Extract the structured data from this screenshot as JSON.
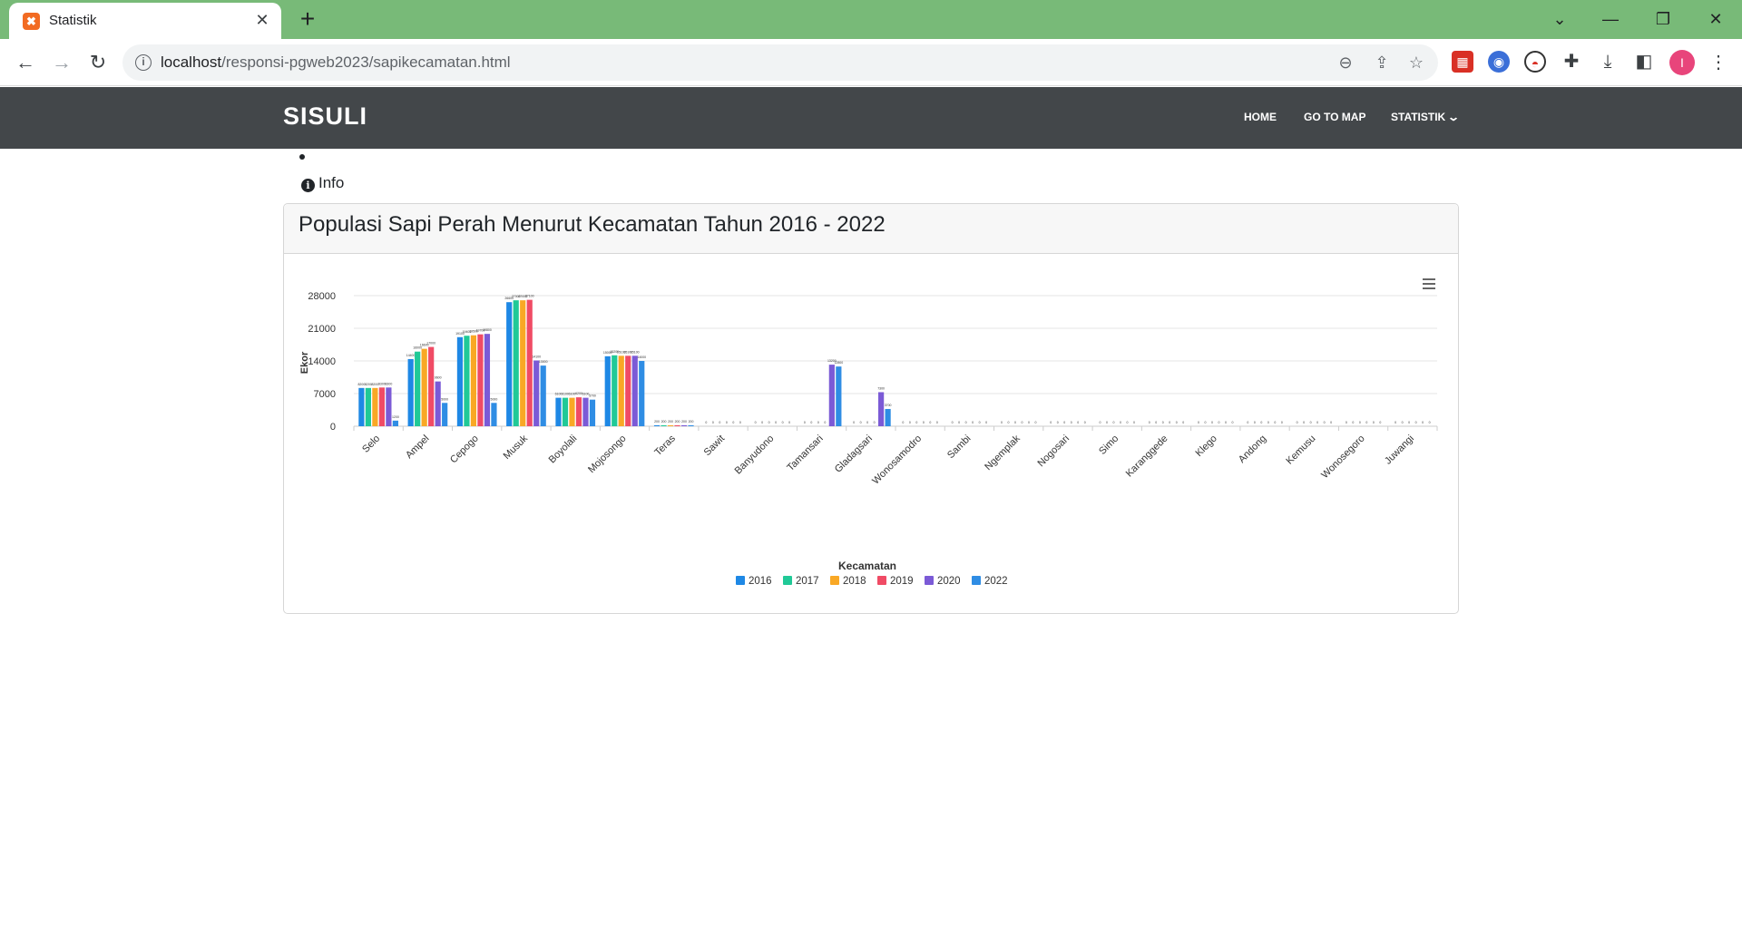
{
  "browser": {
    "tab_title": "Statistik",
    "tab_favicon": "xampp-icon",
    "url_host": "localhost",
    "url_path": "/responsi-pgweb2023/sapikecamatan.html",
    "profile_initial": "I"
  },
  "navbar": {
    "brand": "SISULI",
    "links": [
      "HOME",
      "GO TO MAP",
      "STATISTIK"
    ]
  },
  "info_label": "Info",
  "card_title": "Populasi Sapi Perah Menurut Kecamatan Tahun 2016 - 2022",
  "chart_data": {
    "type": "bar",
    "xlabel": "Kecamatan",
    "ylabel": "Ekor",
    "yticks": [
      "0",
      "7000",
      "14000",
      "21000",
      "28000"
    ],
    "ylim": [
      0,
      28000
    ],
    "grid": true,
    "legend_position": "bottom-center",
    "categories": [
      "Selo",
      "Ampel",
      "Cepogo",
      "Musuk",
      "Boyolali",
      "Mojosongo",
      "Teras",
      "Sawit",
      "Banyudono",
      "Tamansari",
      "Gladagsari",
      "Wonosamodro",
      "Sambi",
      "Ngemplak",
      "Nogosari",
      "Simo",
      "Karanggede",
      "Klego",
      "Andong",
      "Kemusu",
      "Wonosegoro",
      "Juwangi"
    ],
    "series": [
      {
        "name": "2016",
        "color": "#1e88e5",
        "values": [
          8200,
          14400,
          19100,
          26600,
          6100,
          15000,
          200,
          0,
          0,
          0,
          0,
          0,
          0,
          0,
          0,
          0,
          0,
          0,
          0,
          0,
          0,
          0
        ]
      },
      {
        "name": "2017",
        "color": "#20c997",
        "values": [
          8200,
          16000,
          19400,
          27000,
          6100,
          15200,
          200,
          0,
          0,
          0,
          0,
          0,
          0,
          0,
          0,
          0,
          0,
          0,
          0,
          0,
          0,
          0
        ]
      },
      {
        "name": "2018",
        "color": "#f9a825",
        "values": [
          8200,
          16600,
          19500,
          27000,
          6100,
          15100,
          200,
          0,
          0,
          0,
          0,
          0,
          0,
          0,
          0,
          0,
          0,
          0,
          0,
          0,
          0,
          0
        ]
      },
      {
        "name": "2019",
        "color": "#f04b65",
        "values": [
          8300,
          17000,
          19700,
          27100,
          6200,
          15100,
          200,
          0,
          0,
          0,
          0,
          0,
          0,
          0,
          0,
          0,
          0,
          0,
          0,
          0,
          0,
          0
        ]
      },
      {
        "name": "2020",
        "color": "#7b5ad6",
        "values": [
          8300,
          9600,
          19800,
          14100,
          6100,
          15100,
          200,
          0,
          0,
          13200,
          7300,
          0,
          0,
          0,
          0,
          0,
          0,
          0,
          0,
          0,
          0,
          0
        ]
      },
      {
        "name": "2022",
        "color": "#2f8de4",
        "values": [
          1200,
          5000,
          5000,
          13000,
          5700,
          14000,
          200,
          0,
          0,
          12800,
          3700,
          0,
          0,
          0,
          0,
          0,
          0,
          0,
          0,
          0,
          0,
          0
        ]
      }
    ]
  }
}
